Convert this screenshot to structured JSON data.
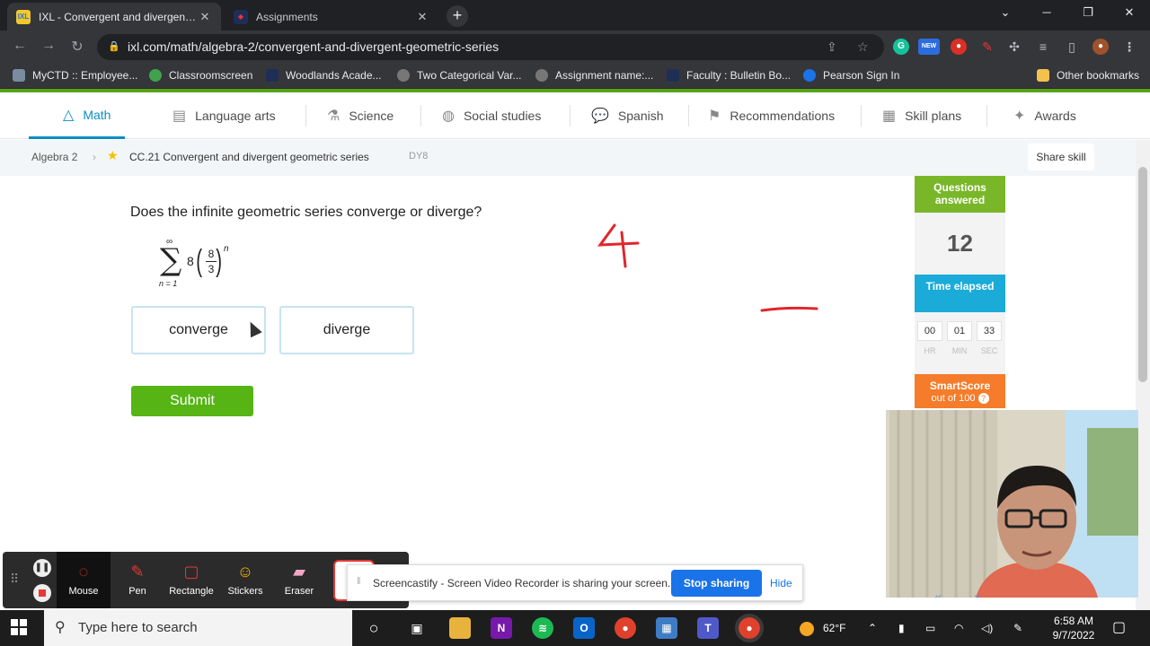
{
  "browser": {
    "tabs": [
      {
        "label": "IXL - Convergent and divergent geometric series",
        "active": true
      },
      {
        "label": "Assignments",
        "active": false
      }
    ],
    "url": "ixl.com/math/algebra-2/convergent-and-divergent-geometric-series",
    "ext_badge": "NEW",
    "bookmarks": [
      "MyCTD :: Employee...",
      "Classroomscreen",
      "Woodlands Acade...",
      "Two Categorical Var...",
      "Assignment name:...",
      "Faculty : Bulletin Bo...",
      "Pearson Sign In"
    ],
    "other_bookmarks": "Other bookmarks"
  },
  "ixl": {
    "subjects": [
      {
        "label": "Math",
        "icon": "pyramid-icon",
        "active": true
      },
      {
        "label": "Language arts",
        "icon": "book-icon"
      },
      {
        "label": "Science",
        "icon": "flask-icon"
      },
      {
        "label": "Social studies",
        "icon": "globe-icon"
      },
      {
        "label": "Spanish",
        "icon": "speech-bubbles-icon"
      },
      {
        "label": "Recommendations",
        "icon": "recommendations-icon"
      },
      {
        "label": "Skill plans",
        "icon": "clipboard-icon"
      },
      {
        "label": "Awards",
        "icon": "awards-icon"
      }
    ],
    "breadcrumb": {
      "course": "Algebra 2",
      "skill": "CC.21 Convergent and divergent geometric series",
      "code": "DY8"
    },
    "share_skill": "Share skill",
    "question": "Does the infinite geometric series converge or diverge?",
    "formula": {
      "upper": "∞",
      "lower": "n = 1",
      "coefficient": "8",
      "numerator": "8",
      "denominator": "3",
      "exponent": "n"
    },
    "answers": [
      "converge",
      "diverge"
    ],
    "submit": "Submit",
    "panel": {
      "questions_label": "Questions answered",
      "questions_value": "12",
      "time_label": "Time elapsed",
      "time": {
        "hr": "00",
        "min": "01",
        "sec": "33"
      },
      "time_units": {
        "hr": "HR",
        "min": "MIN",
        "sec": "SEC"
      },
      "smartscore_label": "SmartScore",
      "smartscore_sub": "out of 100"
    }
  },
  "handwriting": {
    "digit": "4"
  },
  "screencastify": {
    "tools": [
      "Mouse",
      "Pen",
      "Rectangle",
      "Stickers",
      "Eraser"
    ],
    "sharing_message": "Screencastify - Screen Video Recorder is sharing your screen.",
    "stop_sharing": "Stop sharing",
    "hide": "Hide"
  },
  "taskbar": {
    "search_placeholder": "Type here to search",
    "weather": "62°F",
    "time": "6:58 AM",
    "date": "9/7/2022"
  },
  "colors": {
    "ixl_blue": "#0a8dc4",
    "ixl_green": "#56b415",
    "panel_green": "#79b729",
    "panel_blue": "#1aabd9",
    "panel_orange": "#f47c2b",
    "ink_red": "#e0262b"
  }
}
